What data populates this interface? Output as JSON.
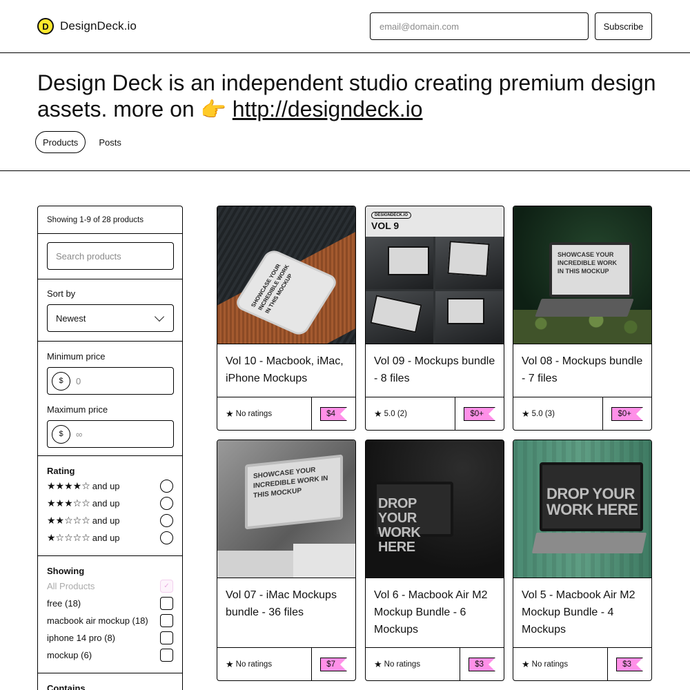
{
  "header": {
    "logo_letter": "D",
    "brand_name": "DesignDeck.io",
    "email_placeholder": "email@domain.com",
    "subscribe_label": "Subscribe"
  },
  "hero": {
    "text": "Design Deck is an independent studio creating premium design assets. more on",
    "pointer_emoji": "👉",
    "link_text": "http://designdeck.io",
    "tabs": [
      "Products",
      "Posts"
    ],
    "active_tab": "Products"
  },
  "sidebar": {
    "showing_count": "Showing 1-9 of 28 products",
    "search_placeholder": "Search products",
    "sort_label": "Sort by",
    "sort_value": "Newest",
    "min_price_label": "Minimum price",
    "min_price_placeholder": "0",
    "max_price_label": "Maximum price",
    "max_price_placeholder": "∞",
    "currency_symbol": "$",
    "rating_heading": "Rating",
    "rating_options": [
      {
        "stars": "★★★★☆",
        "suffix": "and up"
      },
      {
        "stars": "★★★☆☆",
        "suffix": "and up"
      },
      {
        "stars": "★★☆☆☆",
        "suffix": "and up"
      },
      {
        "stars": "★☆☆☆☆",
        "suffix": "and up"
      }
    ],
    "showing_heading": "Showing",
    "showing_options": [
      {
        "label": "All Products",
        "disabled": true
      },
      {
        "label": "free (18)"
      },
      {
        "label": "macbook air mockup (18)"
      },
      {
        "label": "iphone 14 pro (8)"
      },
      {
        "label": "mockup (6)"
      }
    ],
    "contains_heading": "Contains"
  },
  "products": [
    {
      "title": "Vol 10 - Macbook, iMac, iPhone Mockups",
      "rating": "No ratings",
      "price": "$4"
    },
    {
      "title": "Vol 09 - Mockups bundle - 8 files",
      "rating": "5.0 (2)",
      "price": "$0+"
    },
    {
      "title": "Vol 08 - Mockups bundle - 7 files",
      "rating": "5.0 (3)",
      "price": "$0+"
    },
    {
      "title": "Vol 07 - iMac Mockups bundle - 36 files",
      "rating": "No ratings",
      "price": "$7"
    },
    {
      "title": "Vol 6 - Macbook Air M2 Mockup Bundle - 6 Mockups",
      "rating": "No ratings",
      "price": "$3"
    },
    {
      "title": "Vol 5 - Macbook Air M2 Mockup Bundle - 4 Mockups",
      "rating": "No ratings",
      "price": "$3"
    }
  ],
  "thumb_text": {
    "showcase": "SHOWCASE YOUR INCREDIBLE WORK IN THIS MOCKUP",
    "vol9_pill": "DESIGNDECK.IO",
    "vol9_title": "VOL 9",
    "drop": "DROP YOUR WORK HERE"
  },
  "colors": {
    "accent_pink": "#ff90e8",
    "logo_yellow": "#ffe92d",
    "border": "#000000"
  },
  "icons": {
    "star": "star-icon",
    "chevron": "chevron-down-icon",
    "pointer": "pointing-hand-emoji"
  }
}
